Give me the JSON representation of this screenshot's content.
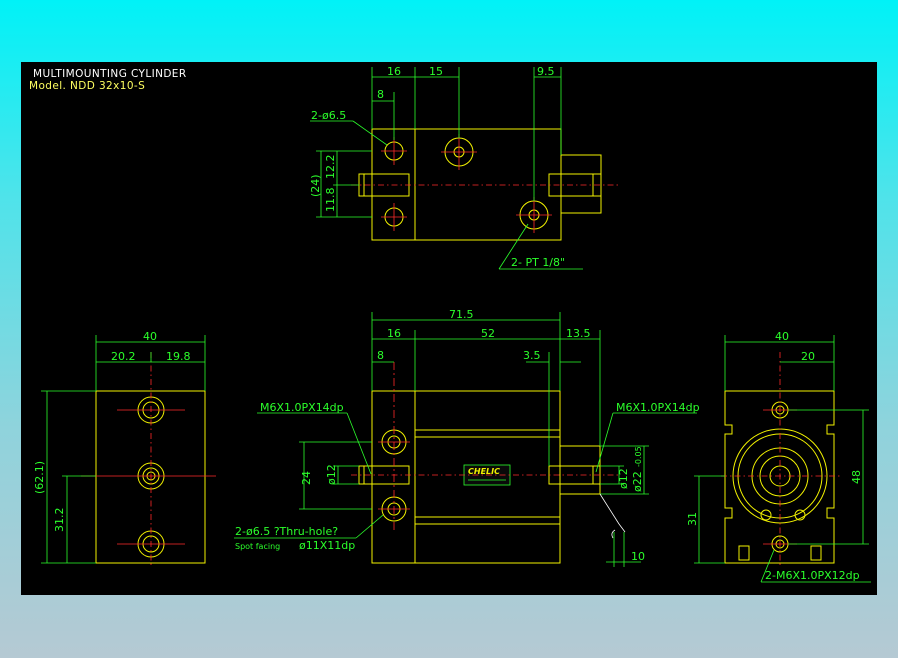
{
  "title": "MULTIMOUNTING CYLINDER",
  "model": "Model. NDD 32x10-S",
  "top_view": {
    "dim_16": "16",
    "dim_15": "15",
    "dim_9_5": "9.5",
    "dim_8": "8",
    "hole_callout": "2-ø6.5",
    "dim_12_2": "12.2",
    "dim_24_ref": "(24)",
    "dim_11_8": "11.8",
    "port_callout": "2- PT 1/8\""
  },
  "front_view": {
    "dim_71_5": "71.5",
    "dim_16": "16",
    "dim_52": "52",
    "dim_13_5": "13.5",
    "dim_8": "8",
    "dim_3_5": "3.5",
    "thread_left": "M6X1.0PX14dp",
    "thread_right": "M6X1.0PX14dp",
    "dim_24": "24",
    "dia_12_left": "ø12",
    "dia_12_right": "ø12",
    "dia_22": "ø22",
    "dia_22_tol": "-0.05",
    "dim_10": "10",
    "hole_callout": "2-ø6.5 ?Thru-hole?",
    "spot_facing_label": "Spot facing",
    "spot_facing_value": "ø11X11dp",
    "brand": "CHELIC"
  },
  "left_view": {
    "dim_40": "40",
    "dim_20_2": "20.2",
    "dim_19_8": "19.8",
    "dim_62_1": "(62.1)",
    "dim_31_2": "31.2"
  },
  "right_view": {
    "dim_40": "40",
    "dim_20": "20",
    "dim_48": "48",
    "dim_31": "31",
    "thread_callout": "2-M6X1.0PX12dp"
  },
  "colors": {
    "background": "#000000",
    "outline": "#f2f200",
    "dimension": "#2bff2b",
    "centerline": "#ff2a2a",
    "title": "#ffffff",
    "model": "#ffff60"
  }
}
